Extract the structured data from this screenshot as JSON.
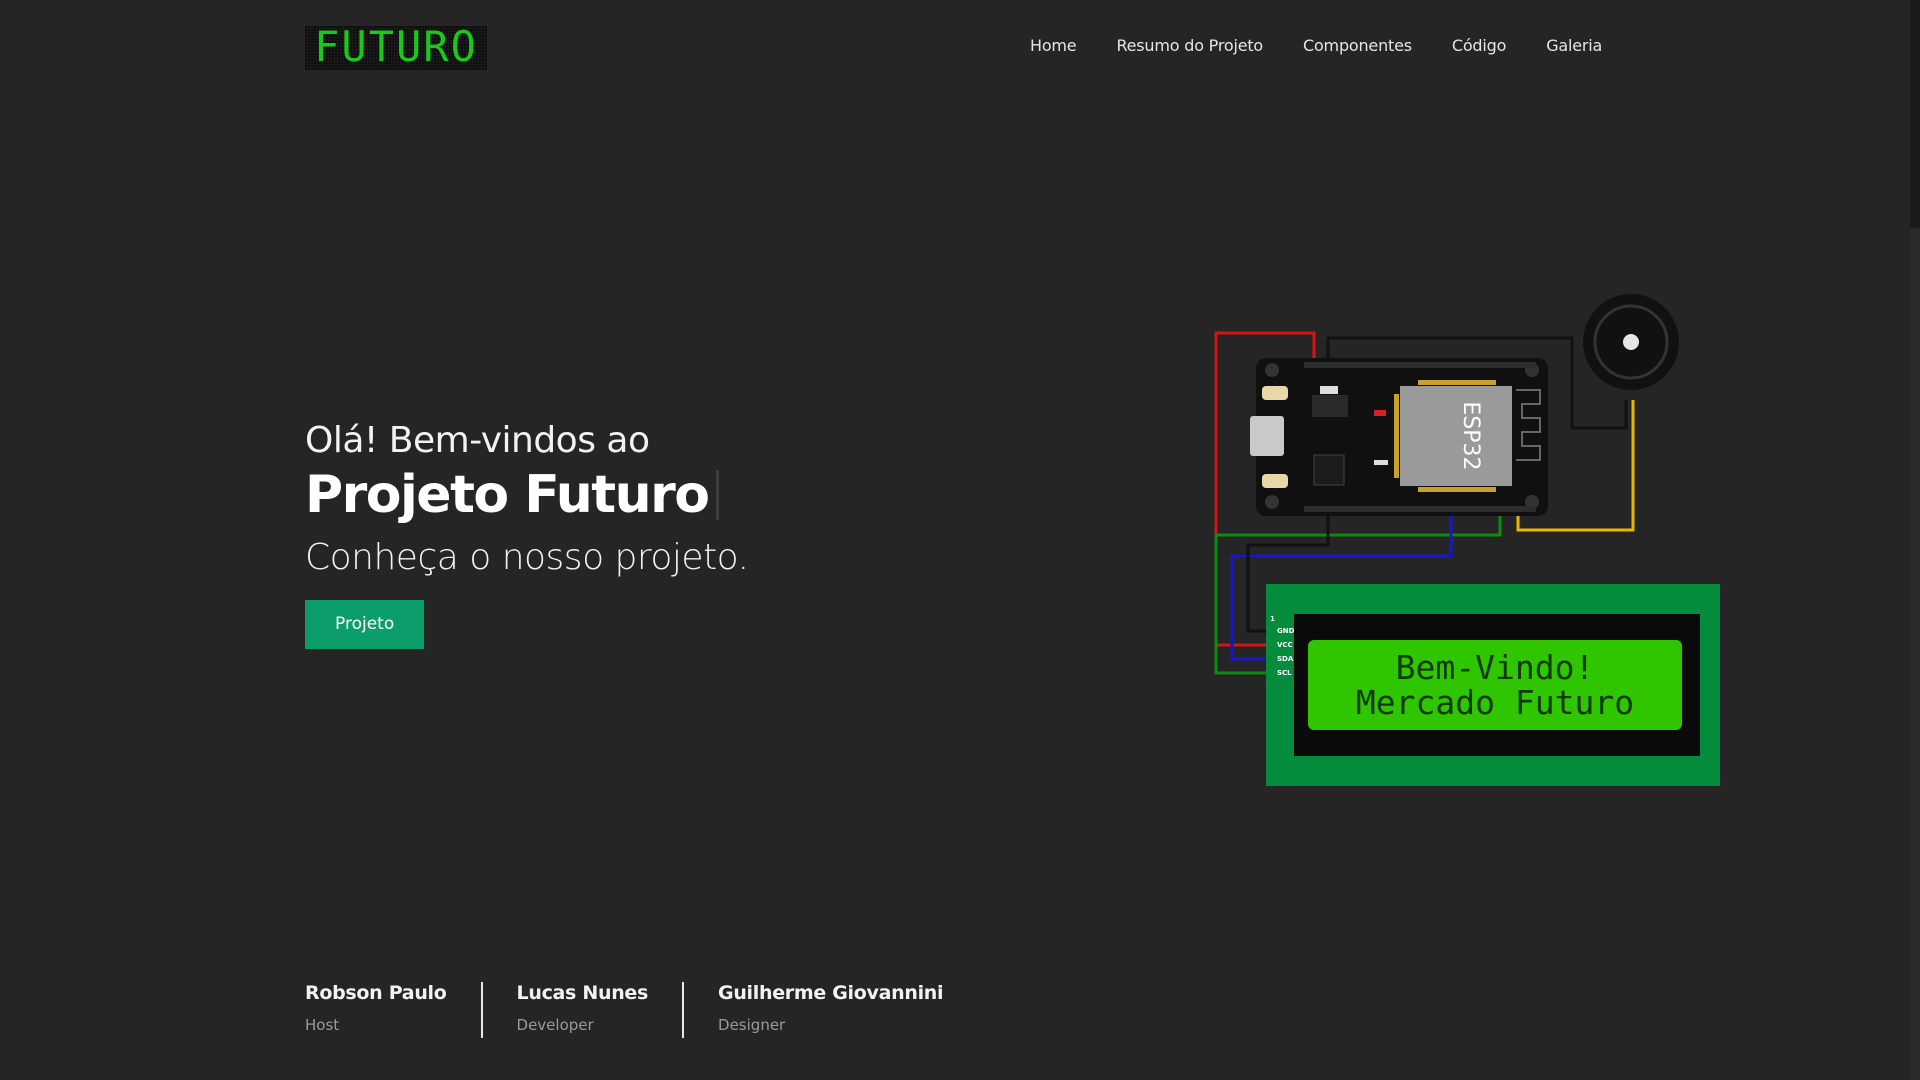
{
  "header": {
    "logo_text": "FUTURO",
    "nav": [
      "Home",
      "Resumo do Projeto",
      "Componentes",
      "Código",
      "Galeria"
    ]
  },
  "hero": {
    "greeting": "Olá! Bem-vindos ao",
    "title": "Projeto Futuro",
    "subtitle": "Conheça o nosso projeto.",
    "cta": "Projeto"
  },
  "illustration": {
    "esp_label": "ESP32",
    "lcd_line1": "Bem-Vindo!",
    "lcd_line2": "Mercado Futuro",
    "lcd_pins": [
      "GND",
      "VCC",
      "SDA",
      "SCL"
    ],
    "lcd_pin_index": "1"
  },
  "team": [
    {
      "name": "Robson Paulo",
      "role": "Host"
    },
    {
      "name": "Lucas Nunes",
      "role": "Developer"
    },
    {
      "name": "Guilherme Giovannini",
      "role": "Designer"
    }
  ],
  "colors": {
    "background": "#252525",
    "accent": "#0b9e6b",
    "logo_green": "#18c918",
    "lcd_board": "#058b3c",
    "lcd_screen": "#2fc600"
  }
}
